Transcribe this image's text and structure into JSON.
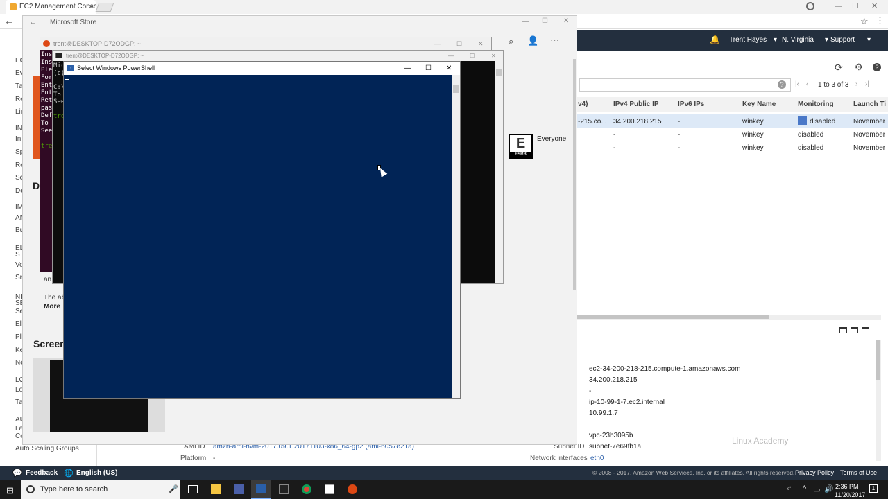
{
  "browser": {
    "tab_title": "EC2 Management Conso",
    "close_tab": "×",
    "minimize": "—",
    "maximize": "☐",
    "close": "✕"
  },
  "aws_header": {
    "user": "Trent Hayes",
    "region": "N. Virginia",
    "support": "Support"
  },
  "aws_left_nav": [
    "EC",
    "Ev",
    "Ta",
    "Re",
    "Lin",
    "IN",
    "In",
    "Sp",
    "Re",
    "Sc",
    "De",
    "IM",
    "AM",
    "Bu",
    "EL",
    "ST",
    "Vo",
    "Sn",
    "NE",
    "SE",
    "Se",
    "Ela",
    "Pla",
    "Ke",
    "Ne",
    "LO",
    "Lo",
    "Ta",
    "AU",
    "La",
    "Co",
    "Auto Scaling Groups"
  ],
  "pagination": "1 to 3 of 3",
  "table": {
    "headers": [
      "v4)",
      "IPv4 Public IP",
      "IPv6 IPs",
      "Key Name",
      "Monitoring",
      "Launch Ti"
    ],
    "rows": [
      [
        "-215.co...",
        "34.200.218.215",
        "-",
        "winkey",
        "disabled",
        "November"
      ],
      [
        "",
        "-",
        "-",
        "winkey",
        "disabled",
        "November"
      ],
      [
        "",
        "-",
        "-",
        "winkey",
        "disabled",
        "November"
      ]
    ]
  },
  "details": {
    "public_dns": "ec2-34-200-218-215.compute-1.amazonaws.com",
    "public_ip": "34.200.218.215",
    "ipv6": "-",
    "private_dns": "ip-10-99-1-7.ec2.internal",
    "private_ip": "10.99.1.7",
    "vpc_id": "vpc-23b3095b",
    "subnet_label": "Subnet ID",
    "subnet_id": "subnet-7e69fb1a",
    "ami_label": "AMI ID",
    "ami_id": "amzn-ami-hvm-2017.09.1.20171103-x86_64-gp2 (ami-6057e21a)",
    "platform_label": "Platform",
    "platform": "-",
    "net_label": "Network interfaces",
    "net": "eth0"
  },
  "watermark": "Linux Academy",
  "store": {
    "title": "Microsoft Store",
    "rating": "Everyone",
    "rating_badge": "E",
    "esrb": "ESRB",
    "screenshots_heading": "Screen",
    "more": "More",
    "partial_text_1": "an",
    "partial_text_2": "The ab",
    "heading_d": "D"
  },
  "ubuntu": {
    "title": "trent@DESKTOP-D72ODGP: ~",
    "lines": [
      "Ins",
      "Ins",
      "Ple",
      "For",
      "Ent",
      "Ent",
      "Ret",
      "pas",
      "Def",
      "To",
      "See",
      "",
      "tre"
    ]
  },
  "cmd": {
    "title": "trent@DESKTOP-D72ODGP: ~",
    "lines": [
      "Mic",
      "(c)",
      "",
      "C:\\",
      "To",
      "See",
      "",
      "tre"
    ]
  },
  "powershell": {
    "title": "Select Windows PowerShell"
  },
  "footer": {
    "feedback": "Feedback",
    "language": "English (US)",
    "copyright": "© 2008 - 2017, Amazon Web Services, Inc. or its affiliates. All rights reserved.",
    "privacy": "Privacy Policy",
    "terms": "Terms of Use"
  },
  "taskbar": {
    "search_placeholder": "Type here to search",
    "time": "2:36 PM",
    "date": "11/20/2017",
    "notification_count": "1"
  }
}
